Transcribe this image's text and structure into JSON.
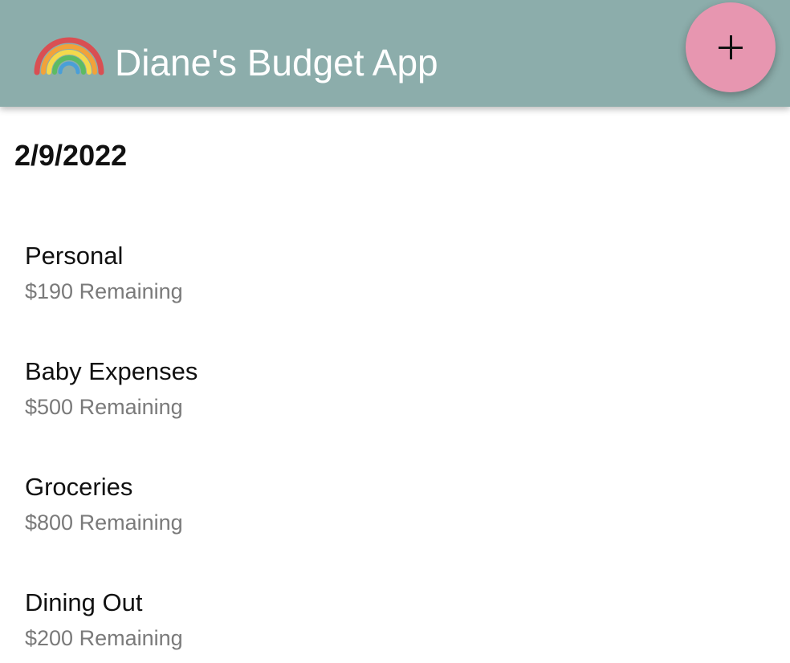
{
  "app_bar": {
    "title": "Diane's Budget App",
    "logo_icon": "rainbow-icon",
    "color": "#8cadab"
  },
  "fab": {
    "icon": "plus-icon",
    "color": "#e796b0"
  },
  "date": "2/9/2022",
  "budgets": [
    {
      "name": "Personal",
      "remaining": "$190 Remaining"
    },
    {
      "name": "Baby Expenses",
      "remaining": "$500 Remaining"
    },
    {
      "name": "Groceries",
      "remaining": "$800 Remaining"
    },
    {
      "name": "Dining Out",
      "remaining": "$200 Remaining"
    }
  ]
}
